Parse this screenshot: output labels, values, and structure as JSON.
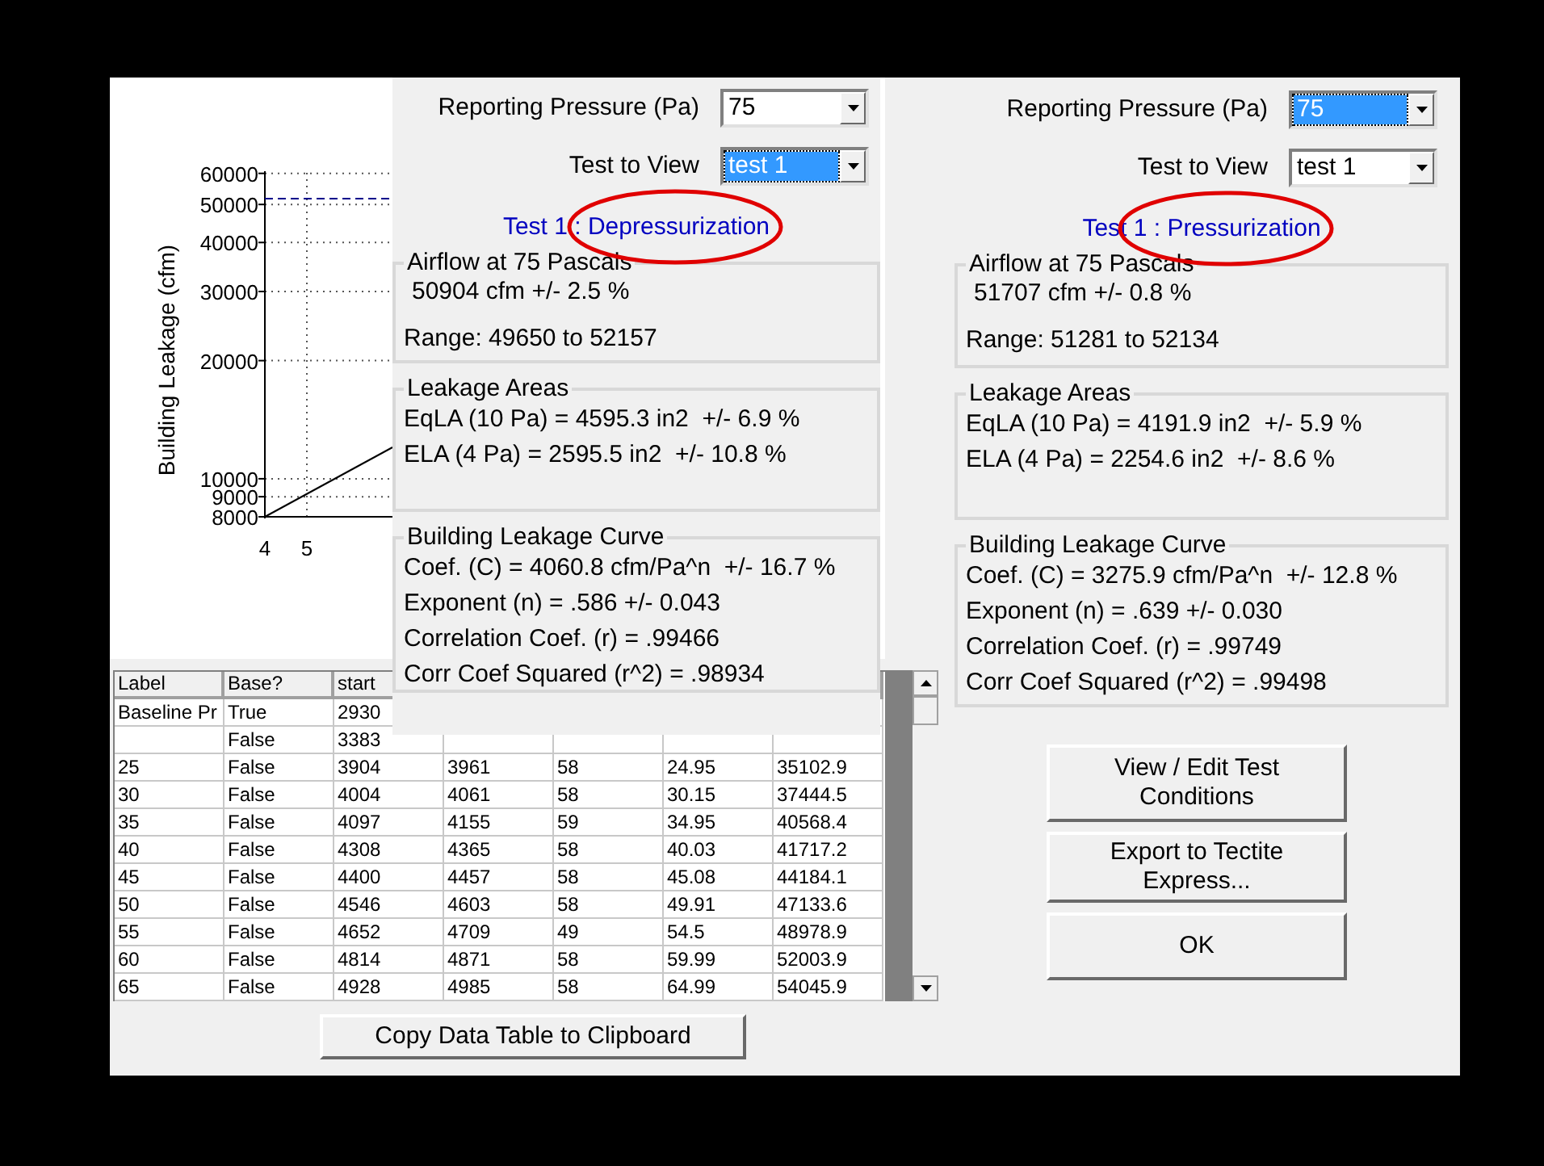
{
  "chart": {
    "y_axis_label": "Building Leakage (cfm)",
    "y_tick_labels": [
      "60000",
      "50000",
      "40000",
      "30000",
      "20000",
      "10000",
      "9000",
      "8000"
    ],
    "x_tick_labels": [
      "4",
      "5"
    ]
  },
  "overlay_panel": {
    "pressure_label": "Reporting Pressure (Pa)",
    "pressure_value": "75",
    "pressure_selected": false,
    "test_label": "Test to View",
    "test_value": "test 1",
    "test_selected": true,
    "heading": "Test 1 : Depressurization",
    "circled": true,
    "groups": [
      {
        "kind": "airflow",
        "title": "Airflow at 75 Pascals",
        "lines": [
          "50904 cfm +/- 2.5 %",
          "Range: 49650 to 52157"
        ]
      },
      {
        "kind": "list",
        "title": "Leakage Areas",
        "lines": [
          "EqLA (10 Pa) = 4595.3 in2  +/- 6.9 %",
          "ELA (4 Pa) = 2595.5 in2  +/- 10.8 %"
        ]
      },
      {
        "kind": "list",
        "title": "Building Leakage Curve",
        "lines": [
          "Coef. (C) = 4060.8 cfm/Pa^n  +/- 16.7 %",
          "Exponent (n) = .586 +/- 0.043",
          "Correlation Coef. (r) = .99466",
          "Corr Coef Squared (r^2) = .98934"
        ]
      }
    ]
  },
  "table": {
    "columns": [
      "Label",
      "Base?",
      "start"
    ],
    "rows": [
      [
        "Baseline Pr",
        "True",
        "2930"
      ],
      [
        null,
        "False",
        "3383"
      ],
      [
        "25",
        "False",
        "3904",
        "3961",
        "58",
        "24.95",
        "35102.9"
      ],
      [
        "30",
        "False",
        "4004",
        "4061",
        "58",
        "30.15",
        "37444.5"
      ],
      [
        "35",
        "False",
        "4097",
        "4155",
        "59",
        "34.95",
        "40568.4"
      ],
      [
        "40",
        "False",
        "4308",
        "4365",
        "58",
        "40.03",
        "41717.2"
      ],
      [
        "45",
        "False",
        "4400",
        "4457",
        "58",
        "45.08",
        "44184.1"
      ],
      [
        "50",
        "False",
        "4546",
        "4603",
        "58",
        "49.91",
        "47133.6"
      ],
      [
        "55",
        "False",
        "4652",
        "4709",
        "49",
        "54.5",
        "48978.9"
      ],
      [
        "60",
        "False",
        "4814",
        "4871",
        "58",
        "59.99",
        "52003.9"
      ],
      [
        "65",
        "False",
        "4928",
        "4985",
        "58",
        "64.99",
        "54045.9"
      ]
    ]
  },
  "copy_button": "Copy Data Table to Clipboard",
  "right_panel": {
    "pressure_label": "Reporting Pressure (Pa)",
    "pressure_value": "75",
    "pressure_selected": true,
    "test_label": "Test to View",
    "test_value": "test 1",
    "test_selected": false,
    "heading": "Test 1 : Pressurization",
    "circled": true,
    "groups": [
      {
        "kind": "airflow",
        "title": "Airflow at 75 Pascals",
        "lines": [
          "51707 cfm +/- 0.8 %",
          "Range: 51281 to 52134"
        ]
      },
      {
        "kind": "list",
        "title": "Leakage Areas",
        "lines": [
          "EqLA (10 Pa) = 4191.9 in2  +/- 5.9 %",
          "ELA (4 Pa) = 2254.6 in2  +/- 8.6 %"
        ]
      },
      {
        "kind": "list",
        "title": "Building Leakage Curve",
        "lines": [
          "Coef. (C) = 3275.9 cfm/Pa^n  +/- 12.8 %",
          "Exponent (n) = .639 +/- 0.030",
          "Correlation Coef. (r) = .99749",
          "Corr Coef Squared (r^2) = .99498"
        ]
      }
    ]
  },
  "buttons": [
    "View / Edit Test Conditions",
    "Export to Tectite Express...",
    "OK"
  ]
}
